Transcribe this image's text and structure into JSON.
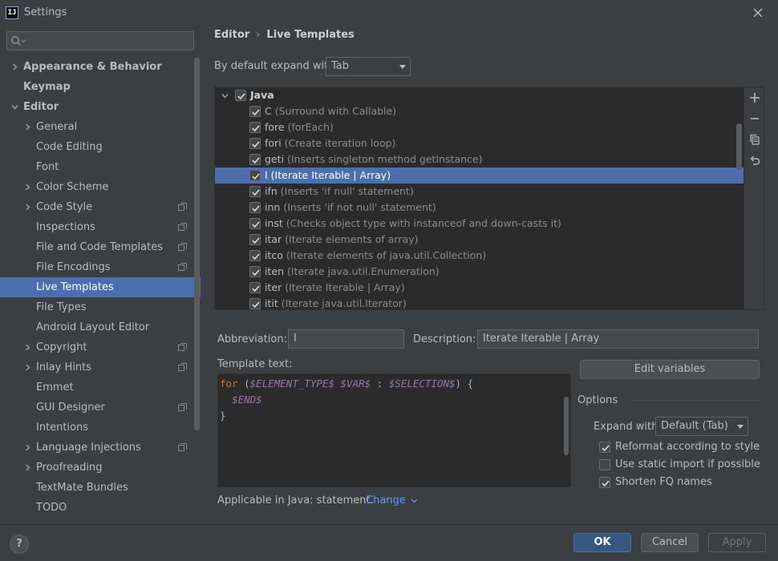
{
  "window": {
    "title": "Settings",
    "logo_text": "IJ"
  },
  "sidebar": {
    "search_placeholder": "",
    "items": [
      {
        "label": "Appearance & Behavior",
        "level": 0,
        "expander": "collapsed",
        "bold": true
      },
      {
        "label": "Keymap",
        "level": 0,
        "expander": "none",
        "bold": true
      },
      {
        "label": "Editor",
        "level": 0,
        "expander": "expanded",
        "bold": true
      },
      {
        "label": "General",
        "level": 1,
        "expander": "collapsed"
      },
      {
        "label": "Code Editing",
        "level": 1,
        "expander": "none"
      },
      {
        "label": "Font",
        "level": 1,
        "expander": "none"
      },
      {
        "label": "Color Scheme",
        "level": 1,
        "expander": "collapsed"
      },
      {
        "label": "Code Style",
        "level": 1,
        "expander": "collapsed",
        "project": true
      },
      {
        "label": "Inspections",
        "level": 1,
        "expander": "none",
        "project": true
      },
      {
        "label": "File and Code Templates",
        "level": 1,
        "expander": "none",
        "project": true
      },
      {
        "label": "File Encodings",
        "level": 1,
        "expander": "none",
        "project": true
      },
      {
        "label": "Live Templates",
        "level": 1,
        "expander": "none",
        "selected": true
      },
      {
        "label": "File Types",
        "level": 1,
        "expander": "none"
      },
      {
        "label": "Android Layout Editor",
        "level": 1,
        "expander": "none"
      },
      {
        "label": "Copyright",
        "level": 1,
        "expander": "collapsed",
        "project": true
      },
      {
        "label": "Inlay Hints",
        "level": 1,
        "expander": "collapsed",
        "project": true
      },
      {
        "label": "Emmet",
        "level": 1,
        "expander": "none"
      },
      {
        "label": "GUI Designer",
        "level": 1,
        "expander": "none",
        "project": true
      },
      {
        "label": "Intentions",
        "level": 1,
        "expander": "none"
      },
      {
        "label": "Language Injections",
        "level": 1,
        "expander": "collapsed",
        "project": true
      },
      {
        "label": "Proofreading",
        "level": 1,
        "expander": "collapsed"
      },
      {
        "label": "TextMate Bundles",
        "level": 1,
        "expander": "none"
      },
      {
        "label": "TODO",
        "level": 1,
        "expander": "none"
      }
    ]
  },
  "breadcrumb": {
    "parent": "Editor",
    "separator": "›",
    "current": "Live Templates"
  },
  "expand_default": {
    "label": "By default expand with",
    "value": "Tab"
  },
  "templates": {
    "group": {
      "name": "Java",
      "checked": true,
      "expanded": true
    },
    "items": [
      {
        "abbr": "C",
        "desc": "(Surround with Callable)",
        "checked": true
      },
      {
        "abbr": "fore",
        "desc": "(forEach)",
        "checked": true
      },
      {
        "abbr": "fori",
        "desc": "(Create iteration loop)",
        "checked": true
      },
      {
        "abbr": "geti",
        "desc": "(Inserts singleton method getInstance)",
        "checked": true
      },
      {
        "abbr": "I",
        "desc": "(Iterate Iterable | Array)",
        "checked": true,
        "selected": true
      },
      {
        "abbr": "ifn",
        "desc": "(Inserts 'if null' statement)",
        "checked": true
      },
      {
        "abbr": "inn",
        "desc": "(Inserts 'if not null' statement)",
        "checked": true
      },
      {
        "abbr": "inst",
        "desc": "(Checks object type with instanceof and down-casts it)",
        "checked": true
      },
      {
        "abbr": "itar",
        "desc": "(Iterate elements of array)",
        "checked": true
      },
      {
        "abbr": "itco",
        "desc": "(Iterate elements of java.util.Collection)",
        "checked": true
      },
      {
        "abbr": "iten",
        "desc": "(Iterate java.util.Enumeration)",
        "checked": true
      },
      {
        "abbr": "iter",
        "desc": "(Iterate Iterable | Array)",
        "checked": true
      },
      {
        "abbr": "itit",
        "desc": "(Iterate java.util.Iterator)",
        "checked": true
      }
    ]
  },
  "toolbar": {
    "add_icon": "plus-icon",
    "remove_icon": "minus-icon",
    "copy_icon": "copy-icon",
    "restore_icon": "undo-icon"
  },
  "abbreviation": {
    "label": "Abbreviation:",
    "value": "I"
  },
  "description": {
    "label": "Description:",
    "value": "Iterate Iterable | Array"
  },
  "template_text": {
    "label": "Template text:",
    "kw_for": "for",
    "line1_open": " (",
    "element_type": "$ELEMENT_TYPE$",
    "sp": " ",
    "var": "$VAR$",
    "colon": " : ",
    "selection": "$SELECTION$",
    "line1_close": ") {",
    "end_indent": "  ",
    "end": "$END$",
    "line3": "}"
  },
  "edit_variables": {
    "label": "Edit variables"
  },
  "options": {
    "title": "Options",
    "expand_with_label": "Expand with",
    "expand_with_value": "Default (Tab)",
    "checkboxes": [
      {
        "label": "Reformat according to style",
        "checked": true
      },
      {
        "label": "Use static import if possible",
        "checked": false
      },
      {
        "label": "Shorten FQ names",
        "checked": true
      }
    ]
  },
  "applicable": {
    "text": "Applicable in Java: statement.",
    "link": "Change"
  },
  "footer": {
    "help": "?",
    "ok": "OK",
    "cancel": "Cancel",
    "apply": "Apply"
  },
  "colors": {
    "selection": "#4b6eaf",
    "background": "#3c3f41",
    "editor_bg": "#2b2b2b",
    "keyword": "#cc7832",
    "variable": "#9876aa",
    "link": "#589df6"
  }
}
